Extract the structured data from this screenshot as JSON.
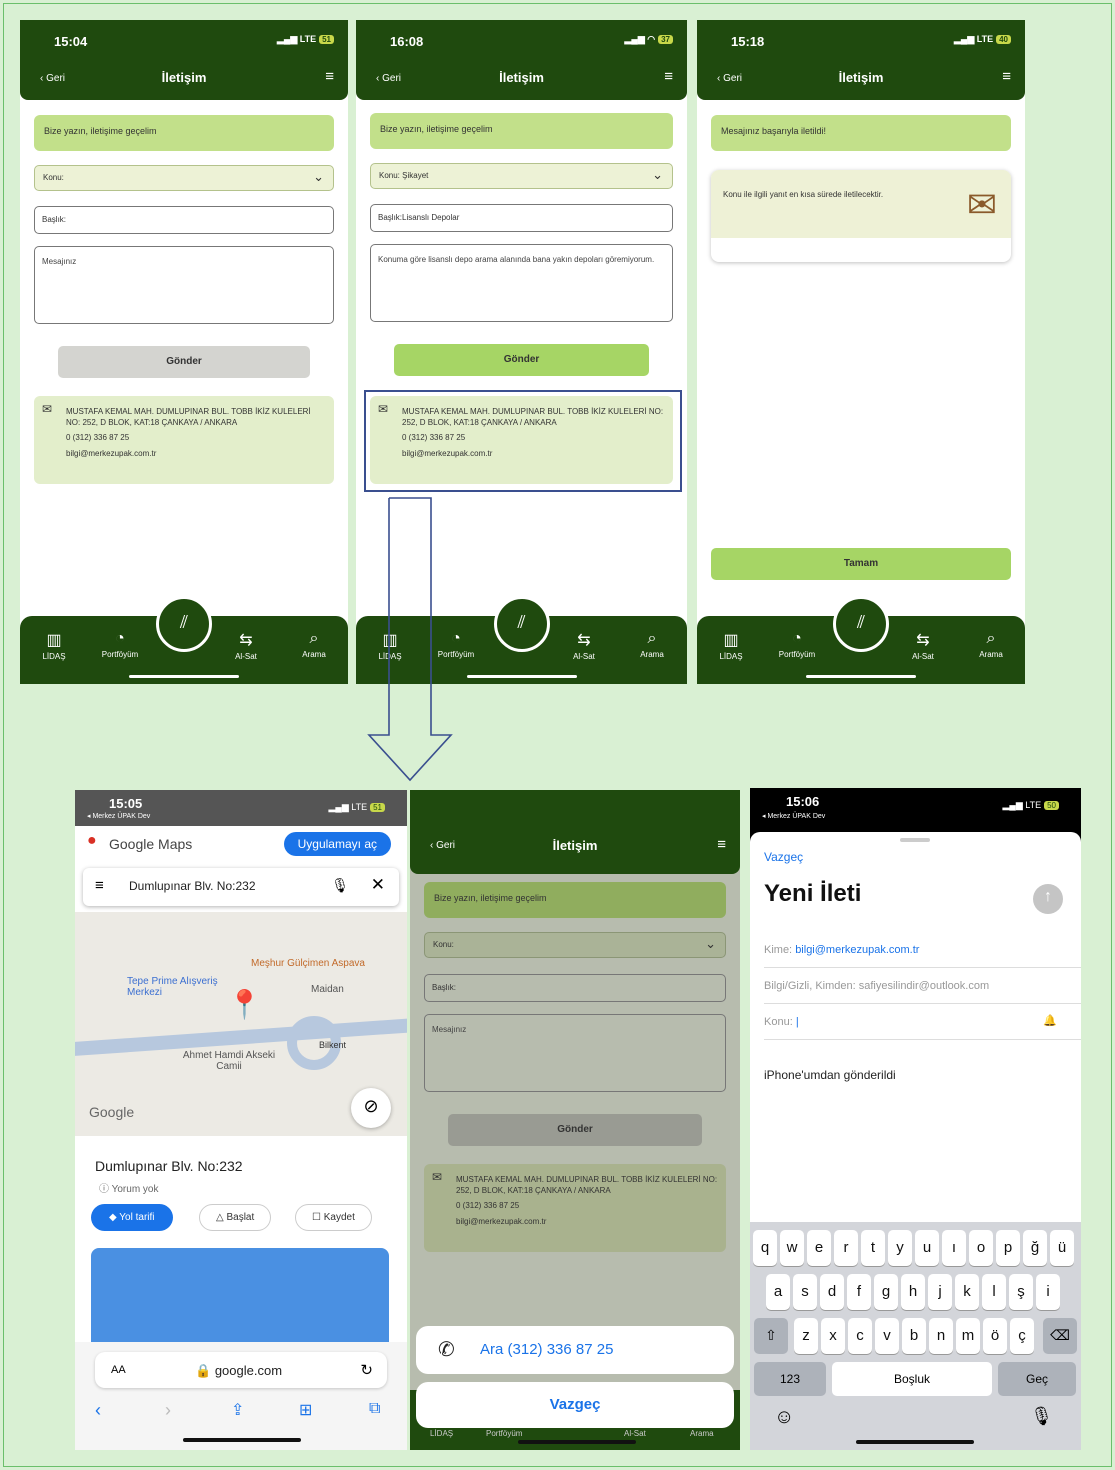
{
  "screens_top": [
    {
      "time": "15:04",
      "signal": "LTE",
      "battery": "51",
      "back": "‹ Geri",
      "title": "İletişim",
      "banner": "Bize yazın, iletişime geçelim",
      "konu": "Konu:",
      "baslik": "Başlık:",
      "mesaj": "Mesajınız",
      "send": "Gönder",
      "address": "MUSTAFA KEMAL MAH. DUMLUPINAR BUL. TOBB İKİZ KULELERİ NO: 252, D BLOK, KAT:18 ÇANKAYA / ANKARA",
      "phone": "0 (312) 336 87 25",
      "email": "bilgi@merkezupak.com.tr"
    },
    {
      "time": "16:08",
      "signal": "",
      "battery": "37",
      "back": "‹ Geri",
      "title": "İletişim",
      "banner": "Bize yazın, iletişime geçelim",
      "konu": "Konu: Şikayet",
      "baslik": "Başlık:Lisanslı Depolar",
      "mesaj": "Konuma göre lisanslı depo arama alanında bana yakın depoları göremiyorum.",
      "send": "Gönder",
      "address": "MUSTAFA KEMAL MAH. DUMLUPINAR BUL. TOBB İKİZ KULELERİ NO: 252, D BLOK, KAT:18 ÇANKAYA / ANKARA",
      "phone": "0 (312) 336 87 25",
      "email": "bilgi@merkezupak.com.tr"
    },
    {
      "time": "15:18",
      "signal": "LTE",
      "battery": "40",
      "back": "‹ Geri",
      "title": "İletişim",
      "banner": "Mesajınız başarıyla iletildi!",
      "card_text": "Konu ile ilgili yanıt en kısa sürede iletilecektir.",
      "ok": "Tamam"
    }
  ],
  "tabbar": {
    "t1": "LİDAŞ",
    "t2": "Portföyüm",
    "t3": "Al-Sat",
    "t4": "Arama"
  },
  "maps": {
    "time": "15:05",
    "back_app": "◂ Merkez ÜPAK Dev",
    "signal": "LTE",
    "battery": "51",
    "brand": "Google Maps",
    "open_app": "Uygulamayı aç",
    "query": "Dumlupınar Blv. No:232",
    "map_labels": [
      "Meşhur Gülçimen Aspava",
      "Tepe Prime Alışveriş Merkezi",
      "Maidan",
      "Ahmet Hamdi Akseki Camii",
      "Bilkent",
      "Google"
    ],
    "place": "Dumlupınar Blv. No:232",
    "reviews": "Yorum yok",
    "b_route": "Yol tarifi",
    "b_start": "Başlat",
    "b_save": "Kaydet",
    "url": "google.com",
    "aa": "AA"
  },
  "call": {
    "back": "‹ Geri",
    "title": "İletişim",
    "banner": "Bize yazın, iletişime geçelim",
    "konu": "Konu:",
    "baslik": "Başlık:",
    "mesaj": "Mesajınız",
    "send": "Gönder",
    "address": "MUSTAFA KEMAL MAH. DUMLUPINAR BUL. TOBB İKİZ KULELERİ NO: 252, D BLOK, KAT:18 ÇANKAYA / ANKARA",
    "phone": "0 (312) 336 87 25",
    "email": "bilgi@merkezupak.com.tr",
    "call_action": "Ara (312) 336 87 25",
    "cancel": "Vazgeç"
  },
  "mail": {
    "time": "15:06",
    "back_app": "◂ Merkez ÜPAK Dev",
    "signal": "LTE",
    "battery": "50",
    "cancel": "Vazgeç",
    "title": "Yeni İleti",
    "to_label": "Kime:",
    "to": "bilgi@merkezupak.com.tr",
    "cc": "Bilgi/Gizli, Kimden: safiyesilindir@outlook.com",
    "subject_label": "Konu:",
    "body": "iPhone'umdan gönderildi",
    "row1": [
      "q",
      "w",
      "e",
      "r",
      "t",
      "y",
      "u",
      "ı",
      "o",
      "p",
      "ğ",
      "ü"
    ],
    "row2": [
      "a",
      "s",
      "d",
      "f",
      "g",
      "h",
      "j",
      "k",
      "l",
      "ş",
      "i"
    ],
    "row3": [
      "z",
      "x",
      "c",
      "v",
      "b",
      "n",
      "m",
      "ö",
      "ç"
    ],
    "k123": "123",
    "space": "Boşluk",
    "go": "Geç"
  }
}
